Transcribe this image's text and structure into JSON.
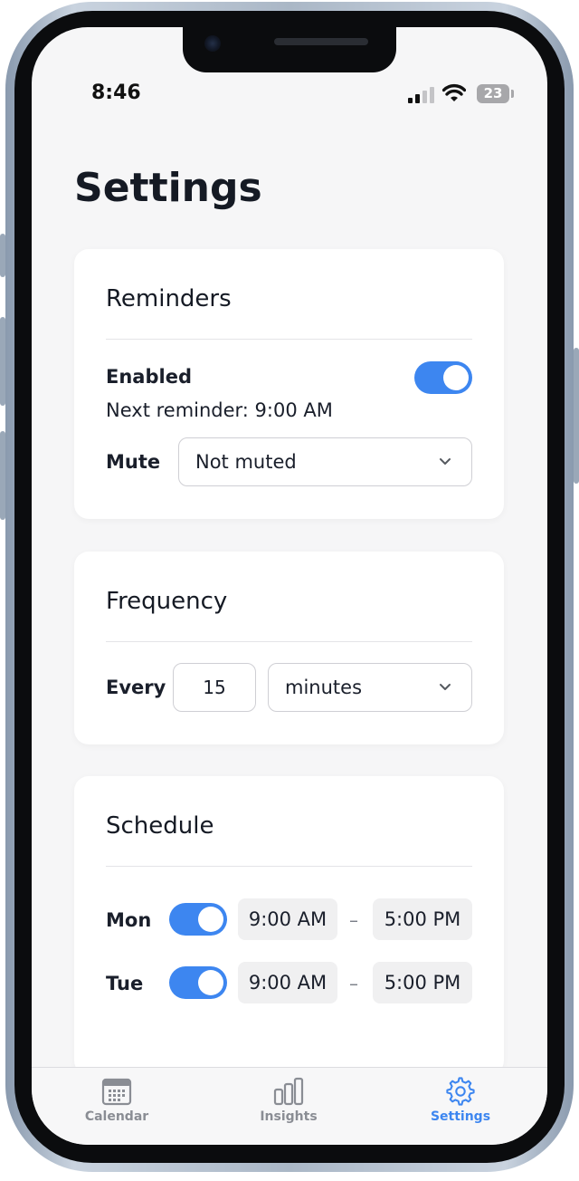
{
  "status_bar": {
    "time": "8:46",
    "battery": "23"
  },
  "page": {
    "title": "Settings"
  },
  "reminders": {
    "title": "Reminders",
    "enabled_label": "Enabled",
    "enabled": true,
    "next_reminder": "Next reminder: 9:00 AM",
    "mute_label": "Mute",
    "mute_value": "Not muted"
  },
  "frequency": {
    "title": "Frequency",
    "every_label": "Every",
    "interval_value": "15",
    "unit_value": "minutes"
  },
  "schedule": {
    "title": "Schedule",
    "separator": "–",
    "days": [
      {
        "day": "Mon",
        "enabled": true,
        "start": "9:00 AM",
        "end": "5:00 PM"
      },
      {
        "day": "Tue",
        "enabled": true,
        "start": "9:00 AM",
        "end": "5:00 PM"
      }
    ]
  },
  "tabbar": {
    "tabs": [
      {
        "label": "Calendar",
        "icon": "calendar-icon",
        "active": false
      },
      {
        "label": "Insights",
        "icon": "bar-chart-icon",
        "active": false
      },
      {
        "label": "Settings",
        "icon": "gear-icon",
        "active": true
      }
    ]
  },
  "colors": {
    "accent": "#3d86f0",
    "text": "#1a1f2b",
    "background": "#f6f6f7"
  }
}
